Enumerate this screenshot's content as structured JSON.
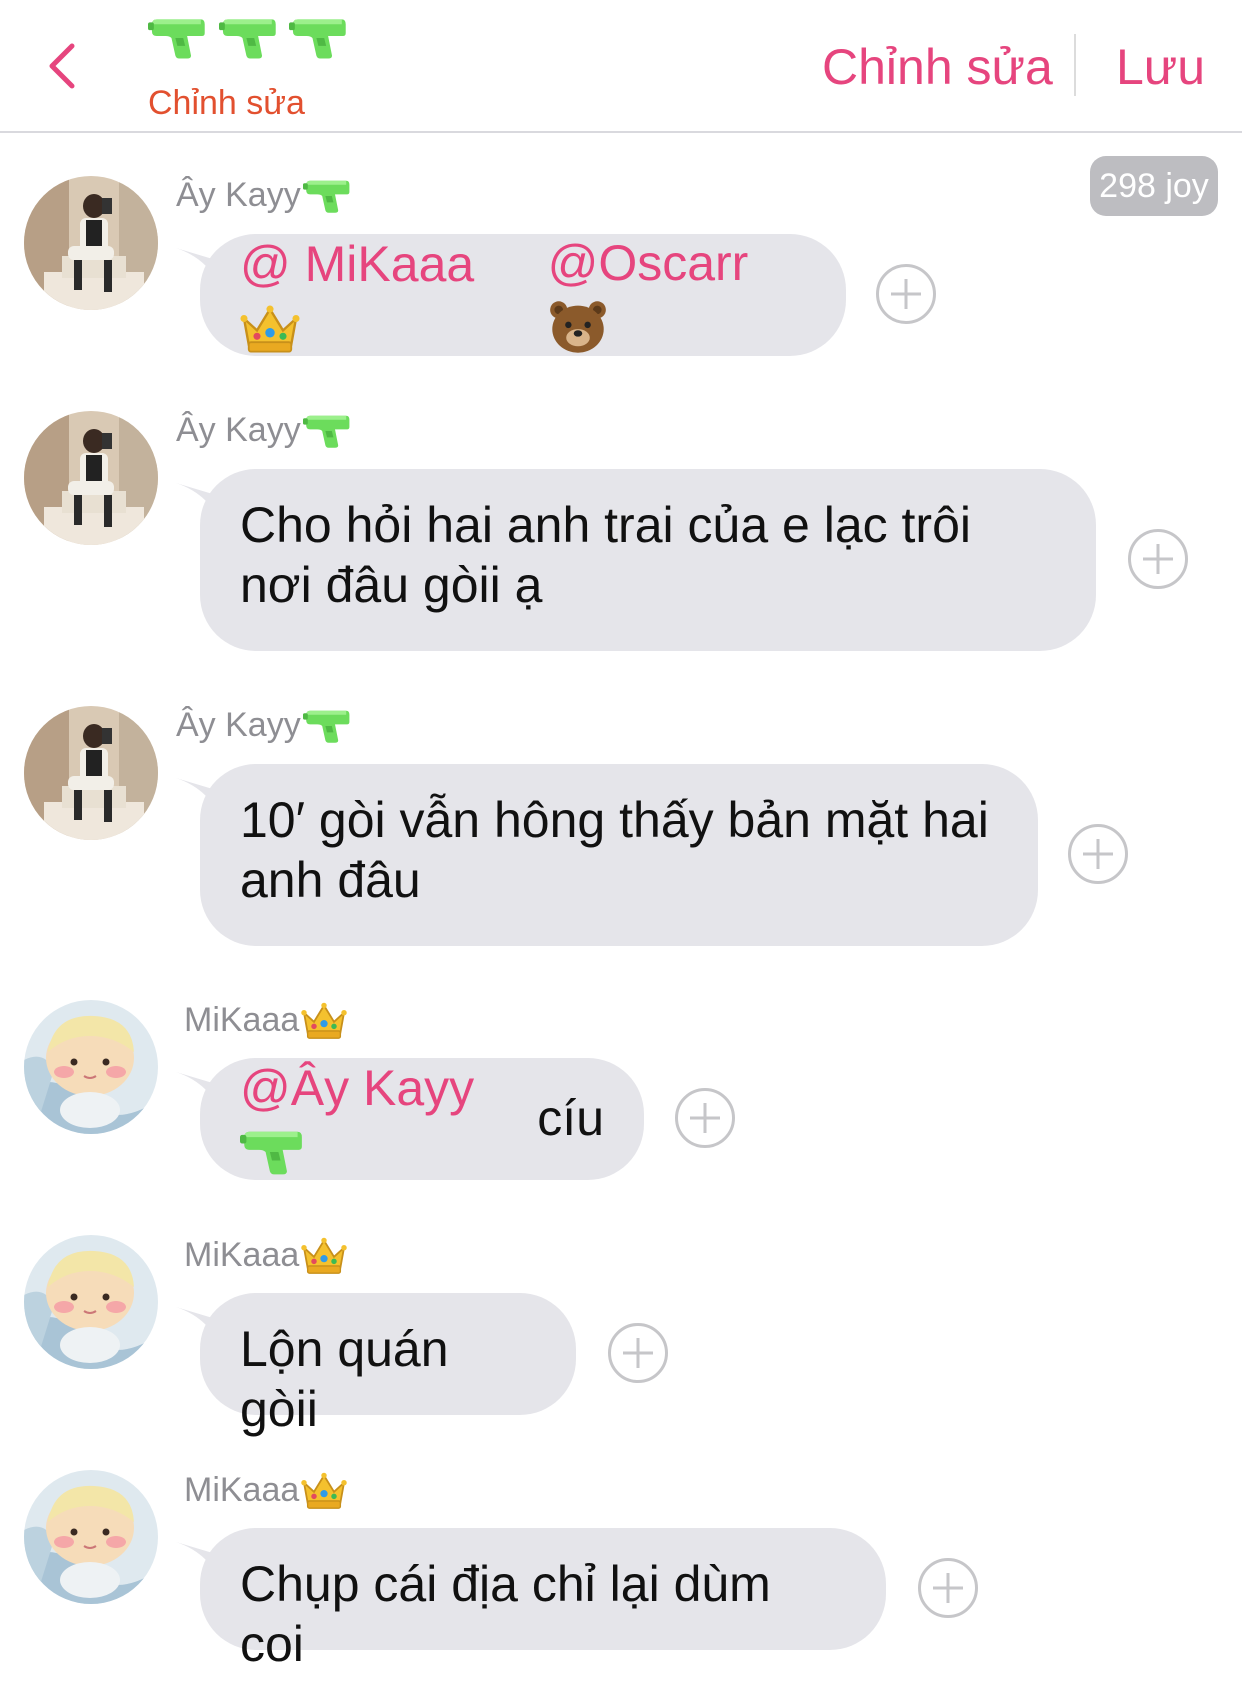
{
  "header": {
    "back_label": "back",
    "title": "Chỉnh sửa",
    "edit_label": "Chỉnh sửa",
    "save_label": "Lưu"
  },
  "joy_badge": "298 joy",
  "colors": {
    "accent": "#e6457e",
    "title": "#e2502f",
    "bubble": "#e5e5ea",
    "gun": "#6cdc5c"
  },
  "messages": [
    {
      "sender": "Ây Kayy",
      "sender_icon": "water-gun-icon",
      "mentions": [
        "@ MiKaaa",
        "@Oscarr"
      ],
      "text": ""
    },
    {
      "sender": "Ây Kayy",
      "sender_icon": "water-gun-icon",
      "text": "Cho hỏi hai anh trai của e lạc trôi nơi đâu gòii ạ"
    },
    {
      "sender": "Ây Kayy",
      "sender_icon": "water-gun-icon",
      "text": "10′ gòi vẫn hông thấy bản mặt hai anh đâu"
    },
    {
      "sender": "MiKaaa",
      "sender_icon": "crown-icon",
      "mention": "@Ây Kayy",
      "text": "cíu"
    },
    {
      "sender": "MiKaaa",
      "sender_icon": "crown-icon",
      "text": "Lộn quán gòii"
    },
    {
      "sender": "MiKaaa",
      "sender_icon": "crown-icon",
      "text": "Chụp cái địa chỉ lại dùm coi"
    }
  ]
}
